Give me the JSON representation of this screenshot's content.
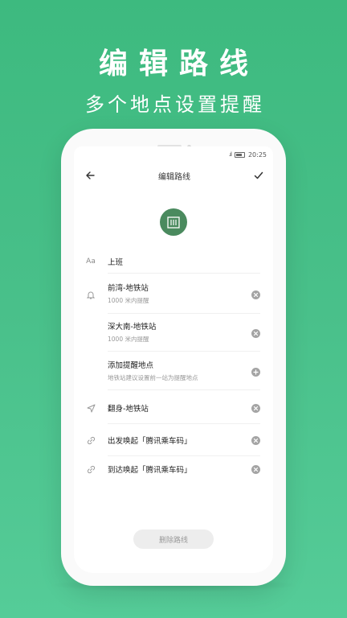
{
  "promo": {
    "headline": "编辑路线",
    "subline": "多个地点设置提醒"
  },
  "status": {
    "time": "20:25",
    "signal": ".ıl"
  },
  "header": {
    "title": "编辑路线"
  },
  "route": {
    "name_prefix_icon": "Aa",
    "name": "上班"
  },
  "reminders": [
    {
      "label": "前湾-地铁站",
      "detail": "1000 米内提醒"
    },
    {
      "label": "深大南-地铁站",
      "detail": "1000 米内提醒"
    }
  ],
  "add_location": {
    "label": "添加提醒地点",
    "detail": "地铁站建议设置前一站为提醒地点"
  },
  "departure": {
    "label": "翻身-地铁站"
  },
  "wake_on_depart": {
    "label": "出发唤起「腾讯乘车码」"
  },
  "wake_on_arrive": {
    "label": "到达唤起「腾讯乘车码」"
  },
  "actions": {
    "delete_label": "删除路线"
  },
  "colors": {
    "background": "#4bc08a",
    "accent": "#4a8a5e"
  }
}
